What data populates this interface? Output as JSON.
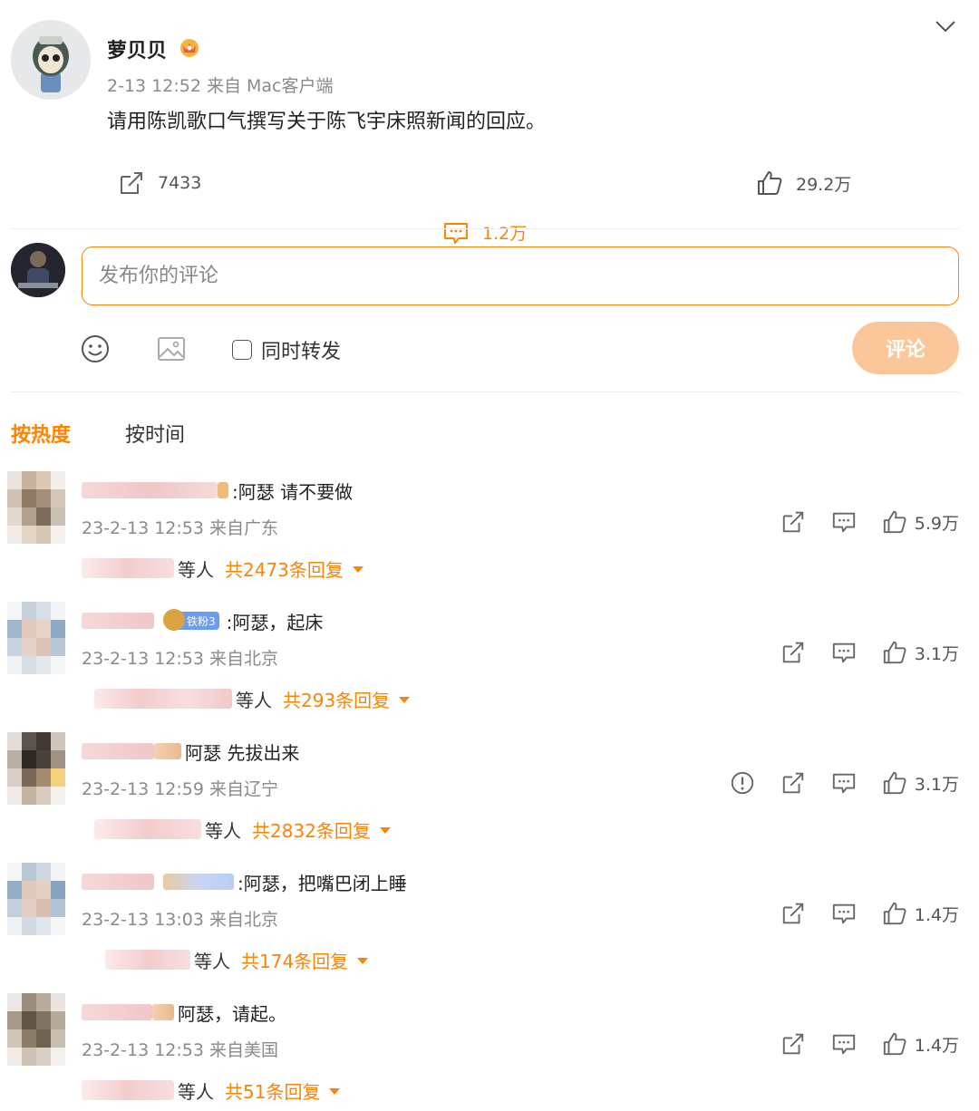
{
  "post": {
    "author": "萝贝贝",
    "meta": "2-13 12:52  来自 Mac客户端",
    "text": "请用陈凯歌口气撰写关于陈飞宇床照新闻的回应。",
    "reposts": "7433",
    "comments": "1.2万",
    "likes": "29.2万"
  },
  "composer": {
    "placeholder": "发布你的评论",
    "repost_label": "同时转发",
    "submit_label": "评论"
  },
  "sort": {
    "hot": "按热度",
    "time": "按时间"
  },
  "comments": [
    {
      "text": ":阿瑟 请不要做",
      "meta": "23-2-13 12:53 来自广东",
      "likes": "5.9万",
      "replies_prefix": "等人",
      "replies_total": "共2473条回复"
    },
    {
      "badge": "铁粉3",
      "text": ":阿瑟，起床",
      "meta": "23-2-13 12:53 来自北京",
      "likes": "3.1万",
      "replies_prefix": "等人",
      "replies_total": "共293条回复"
    },
    {
      "text": "阿瑟 先拔出来",
      "meta": "23-2-13 12:59 来自辽宁",
      "likes": "3.1万",
      "replies_prefix": "等人",
      "replies_total": "共2832条回复"
    },
    {
      "text": ":阿瑟，把嘴巴闭上睡",
      "meta": "23-2-13 13:03 来自北京",
      "likes": "1.4万",
      "replies_prefix": "等人",
      "replies_total": "共174条回复"
    },
    {
      "text": "阿瑟，请起。",
      "meta": "23-2-13 12:53 来自美国",
      "likes": "1.4万",
      "replies_prefix": "等人",
      "replies_total": "共51条回复"
    }
  ],
  "colors": {
    "accent": "#ff8200",
    "submit_disabled": "#fbc79a",
    "muted_text": "#8a8a8a"
  },
  "icons": [
    "chevron-down-icon",
    "crown-icon",
    "repost-icon",
    "comment-icon",
    "like-icon",
    "emoji-icon",
    "image-icon",
    "report-icon"
  ]
}
